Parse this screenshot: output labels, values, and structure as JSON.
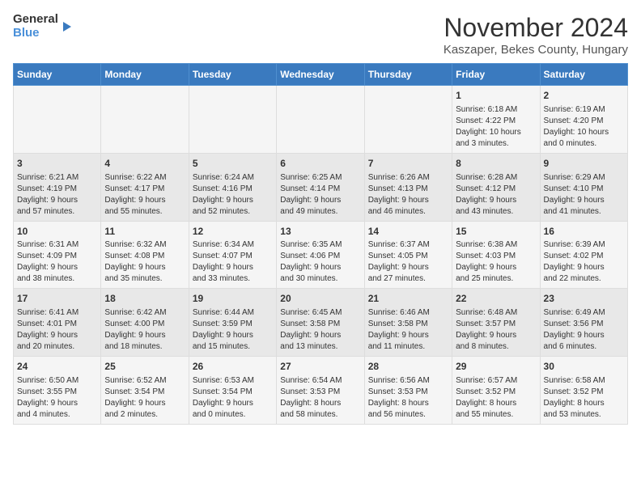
{
  "logo": {
    "general": "General",
    "blue": "Blue"
  },
  "title": "November 2024",
  "subtitle": "Kaszaper, Bekes County, Hungary",
  "days_of_week": [
    "Sunday",
    "Monday",
    "Tuesday",
    "Wednesday",
    "Thursday",
    "Friday",
    "Saturday"
  ],
  "weeks": [
    [
      {
        "day": "",
        "info": ""
      },
      {
        "day": "",
        "info": ""
      },
      {
        "day": "",
        "info": ""
      },
      {
        "day": "",
        "info": ""
      },
      {
        "day": "",
        "info": ""
      },
      {
        "day": "1",
        "info": "Sunrise: 6:18 AM\nSunset: 4:22 PM\nDaylight: 10 hours\nand 3 minutes."
      },
      {
        "day": "2",
        "info": "Sunrise: 6:19 AM\nSunset: 4:20 PM\nDaylight: 10 hours\nand 0 minutes."
      }
    ],
    [
      {
        "day": "3",
        "info": "Sunrise: 6:21 AM\nSunset: 4:19 PM\nDaylight: 9 hours\nand 57 minutes."
      },
      {
        "day": "4",
        "info": "Sunrise: 6:22 AM\nSunset: 4:17 PM\nDaylight: 9 hours\nand 55 minutes."
      },
      {
        "day": "5",
        "info": "Sunrise: 6:24 AM\nSunset: 4:16 PM\nDaylight: 9 hours\nand 52 minutes."
      },
      {
        "day": "6",
        "info": "Sunrise: 6:25 AM\nSunset: 4:14 PM\nDaylight: 9 hours\nand 49 minutes."
      },
      {
        "day": "7",
        "info": "Sunrise: 6:26 AM\nSunset: 4:13 PM\nDaylight: 9 hours\nand 46 minutes."
      },
      {
        "day": "8",
        "info": "Sunrise: 6:28 AM\nSunset: 4:12 PM\nDaylight: 9 hours\nand 43 minutes."
      },
      {
        "day": "9",
        "info": "Sunrise: 6:29 AM\nSunset: 4:10 PM\nDaylight: 9 hours\nand 41 minutes."
      }
    ],
    [
      {
        "day": "10",
        "info": "Sunrise: 6:31 AM\nSunset: 4:09 PM\nDaylight: 9 hours\nand 38 minutes."
      },
      {
        "day": "11",
        "info": "Sunrise: 6:32 AM\nSunset: 4:08 PM\nDaylight: 9 hours\nand 35 minutes."
      },
      {
        "day": "12",
        "info": "Sunrise: 6:34 AM\nSunset: 4:07 PM\nDaylight: 9 hours\nand 33 minutes."
      },
      {
        "day": "13",
        "info": "Sunrise: 6:35 AM\nSunset: 4:06 PM\nDaylight: 9 hours\nand 30 minutes."
      },
      {
        "day": "14",
        "info": "Sunrise: 6:37 AM\nSunset: 4:05 PM\nDaylight: 9 hours\nand 27 minutes."
      },
      {
        "day": "15",
        "info": "Sunrise: 6:38 AM\nSunset: 4:03 PM\nDaylight: 9 hours\nand 25 minutes."
      },
      {
        "day": "16",
        "info": "Sunrise: 6:39 AM\nSunset: 4:02 PM\nDaylight: 9 hours\nand 22 minutes."
      }
    ],
    [
      {
        "day": "17",
        "info": "Sunrise: 6:41 AM\nSunset: 4:01 PM\nDaylight: 9 hours\nand 20 minutes."
      },
      {
        "day": "18",
        "info": "Sunrise: 6:42 AM\nSunset: 4:00 PM\nDaylight: 9 hours\nand 18 minutes."
      },
      {
        "day": "19",
        "info": "Sunrise: 6:44 AM\nSunset: 3:59 PM\nDaylight: 9 hours\nand 15 minutes."
      },
      {
        "day": "20",
        "info": "Sunrise: 6:45 AM\nSunset: 3:58 PM\nDaylight: 9 hours\nand 13 minutes."
      },
      {
        "day": "21",
        "info": "Sunrise: 6:46 AM\nSunset: 3:58 PM\nDaylight: 9 hours\nand 11 minutes."
      },
      {
        "day": "22",
        "info": "Sunrise: 6:48 AM\nSunset: 3:57 PM\nDaylight: 9 hours\nand 8 minutes."
      },
      {
        "day": "23",
        "info": "Sunrise: 6:49 AM\nSunset: 3:56 PM\nDaylight: 9 hours\nand 6 minutes."
      }
    ],
    [
      {
        "day": "24",
        "info": "Sunrise: 6:50 AM\nSunset: 3:55 PM\nDaylight: 9 hours\nand 4 minutes."
      },
      {
        "day": "25",
        "info": "Sunrise: 6:52 AM\nSunset: 3:54 PM\nDaylight: 9 hours\nand 2 minutes."
      },
      {
        "day": "26",
        "info": "Sunrise: 6:53 AM\nSunset: 3:54 PM\nDaylight: 9 hours\nand 0 minutes."
      },
      {
        "day": "27",
        "info": "Sunrise: 6:54 AM\nSunset: 3:53 PM\nDaylight: 8 hours\nand 58 minutes."
      },
      {
        "day": "28",
        "info": "Sunrise: 6:56 AM\nSunset: 3:53 PM\nDaylight: 8 hours\nand 56 minutes."
      },
      {
        "day": "29",
        "info": "Sunrise: 6:57 AM\nSunset: 3:52 PM\nDaylight: 8 hours\nand 55 minutes."
      },
      {
        "day": "30",
        "info": "Sunrise: 6:58 AM\nSunset: 3:52 PM\nDaylight: 8 hours\nand 53 minutes."
      }
    ]
  ]
}
